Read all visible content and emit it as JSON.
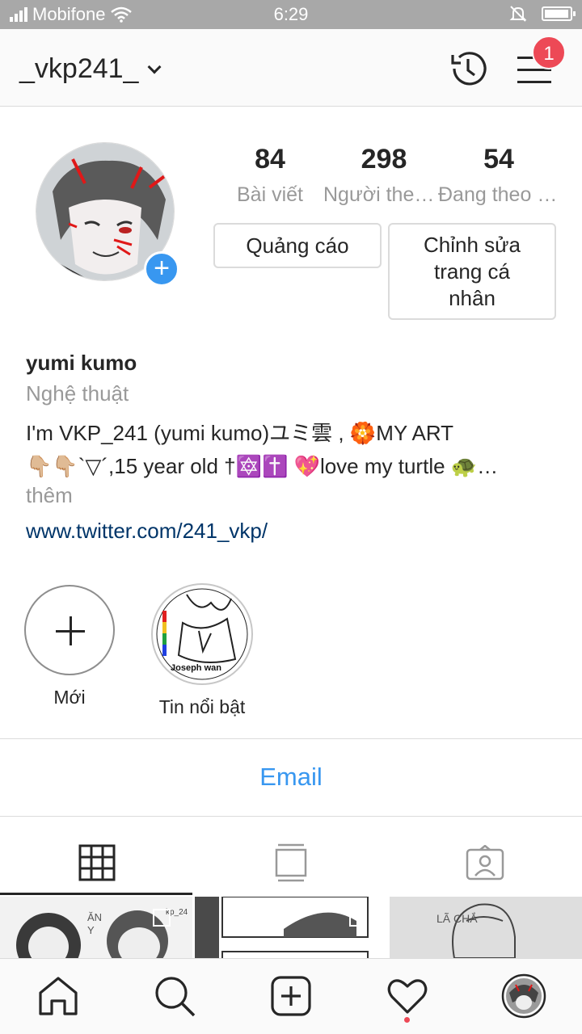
{
  "status_bar": {
    "carrier": "Mobifone",
    "time": "6:29",
    "battery_level": 0.95
  },
  "header": {
    "username": "_vkp241_",
    "notification_count": "1",
    "icons": [
      "chevron-down-icon",
      "history-icon",
      "menu-icon"
    ]
  },
  "profile": {
    "stats": [
      {
        "value": "84",
        "label": "Bài viết"
      },
      {
        "value": "298",
        "label": "Người theo dõi"
      },
      {
        "value": "54",
        "label": "Đang theo dõi"
      }
    ],
    "buttons": {
      "ad": "Quảng cáo",
      "edit_lines": [
        "Chỉnh sửa",
        "trang cá",
        "nhân"
      ]
    },
    "bio": {
      "name": "yumi kumo",
      "category": "Nghệ thuật",
      "text_line1": "I'm VKP_241 (yumi kumo)ユミ雲 , 🏵️MY ART",
      "text_line2": "👇🏼👇🏼`▽´,15 year old †🔯✝️ 💖love my turtle 🐢…",
      "more": "thêm",
      "link": "www.twitter.com/241_vkp/"
    }
  },
  "highlights": [
    {
      "label": "Mới",
      "type": "new"
    },
    {
      "label": "Tin nổi bật",
      "type": "story",
      "thumb_caption": "Joseph wan"
    }
  ],
  "contact": {
    "email_label": "Email"
  },
  "tabs": [
    "grid-icon",
    "feed-icon",
    "tagged-icon"
  ],
  "grid_preview": [
    {
      "caption_a": "ĂN",
      "caption_b": "Y",
      "caption_c": "kp_24"
    },
    {
      "caption": ""
    },
    {
      "caption": "LÃ CHẮ"
    }
  ],
  "bottom_nav": [
    "home-icon",
    "search-icon",
    "new-post-icon",
    "activity-icon",
    "profile-avatar"
  ],
  "colors": {
    "accent": "#3897f0",
    "badge": "#ed4956",
    "link": "#003569",
    "muted": "#999999",
    "text": "#262626"
  }
}
